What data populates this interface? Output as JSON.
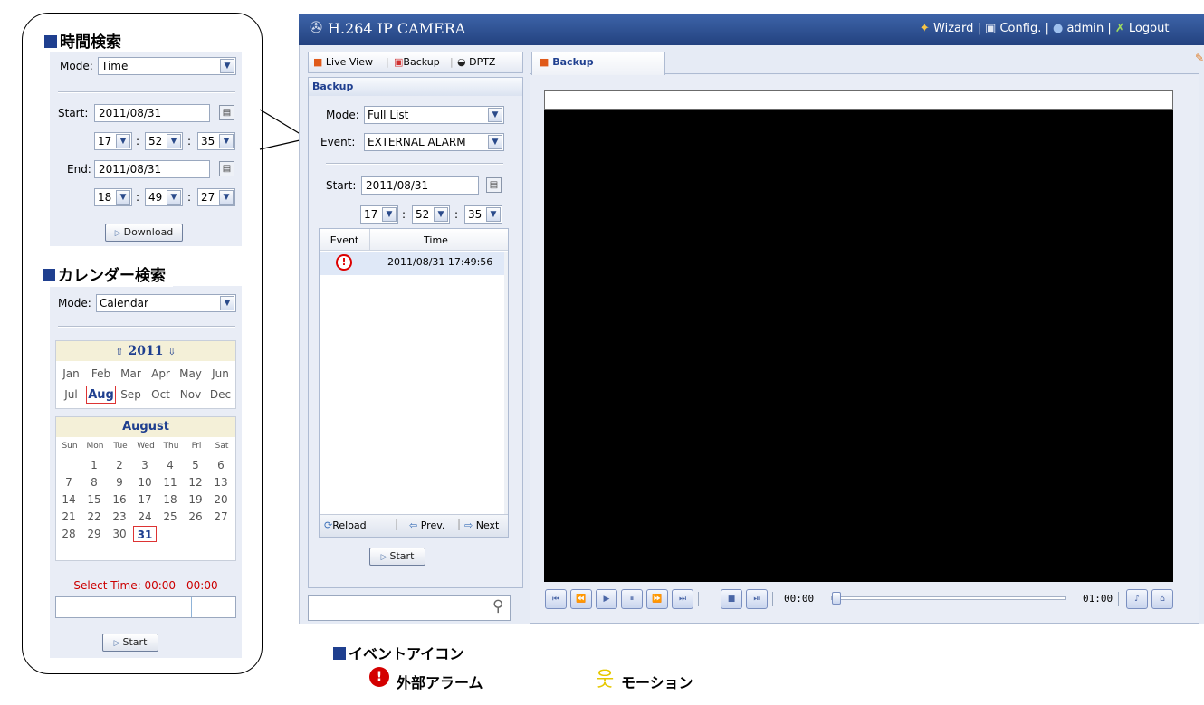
{
  "left_panel": {
    "time_title": "時間検索",
    "mode_label": "Mode:",
    "mode_value": "Time",
    "start_label": "Start:",
    "start_date": "2011/08/31",
    "start_h": "17",
    "start_m": "52",
    "start_s": "35",
    "end_label": "End:",
    "end_date": "2011/08/31",
    "end_h": "18",
    "end_m": "49",
    "end_s": "27",
    "download_label": "Download",
    "calendar_title": "カレンダー検索",
    "mode2_value": "Calendar",
    "year": "2011",
    "months": [
      "Jan",
      "Feb",
      "Mar",
      "Apr",
      "May",
      "Jun",
      "Jul",
      "Aug",
      "Sep",
      "Oct",
      "Nov",
      "Dec"
    ],
    "month_title": "August",
    "weekdays": [
      "Sun",
      "Mon",
      "Tue",
      "Wed",
      "Thu",
      "Fri",
      "Sat"
    ],
    "days": [
      "1",
      "2",
      "3",
      "4",
      "5",
      "6",
      "7",
      "8",
      "9",
      "10",
      "11",
      "12",
      "13",
      "14",
      "15",
      "16",
      "17",
      "18",
      "19",
      "20",
      "21",
      "22",
      "23",
      "24",
      "25",
      "26",
      "27",
      "28",
      "29",
      "30",
      "31"
    ],
    "select_time": "Select Time: 00:00 - 00:00",
    "start_btn": "Start"
  },
  "header": {
    "title": "H.264 IP CAMERA",
    "wizard": "Wizard",
    "config": "Config.",
    "user": "admin",
    "logout": "Logout"
  },
  "sidebar": {
    "tabs": {
      "live": "Live View",
      "backup": "Backup",
      "ptz": "DPTZ"
    },
    "section_title": "Backup",
    "mode_label": "Mode:",
    "mode_value": "Full List",
    "event_label": "Event:",
    "event_value": "EXTERNAL ALARM",
    "start_label": "Start:",
    "start_date": "2011/08/31",
    "h": "17",
    "m": "52",
    "s": "35",
    "col_event": "Event",
    "col_time": "Time",
    "row_time": "2011/08/31 17:49:56",
    "reload": "Reload",
    "prev": "Prev.",
    "next": "Next",
    "start_btn": "Start"
  },
  "main": {
    "tab_label": "Backup",
    "time_start": "00:00",
    "time_end": "01:00"
  },
  "legend": {
    "title": "イベントアイコン",
    "alarm": "外部アラーム",
    "motion": "モーション"
  },
  "colors": {
    "header": "#2c4d8e",
    "panel": "#e9edf6",
    "accent_red": "#cc0000"
  }
}
